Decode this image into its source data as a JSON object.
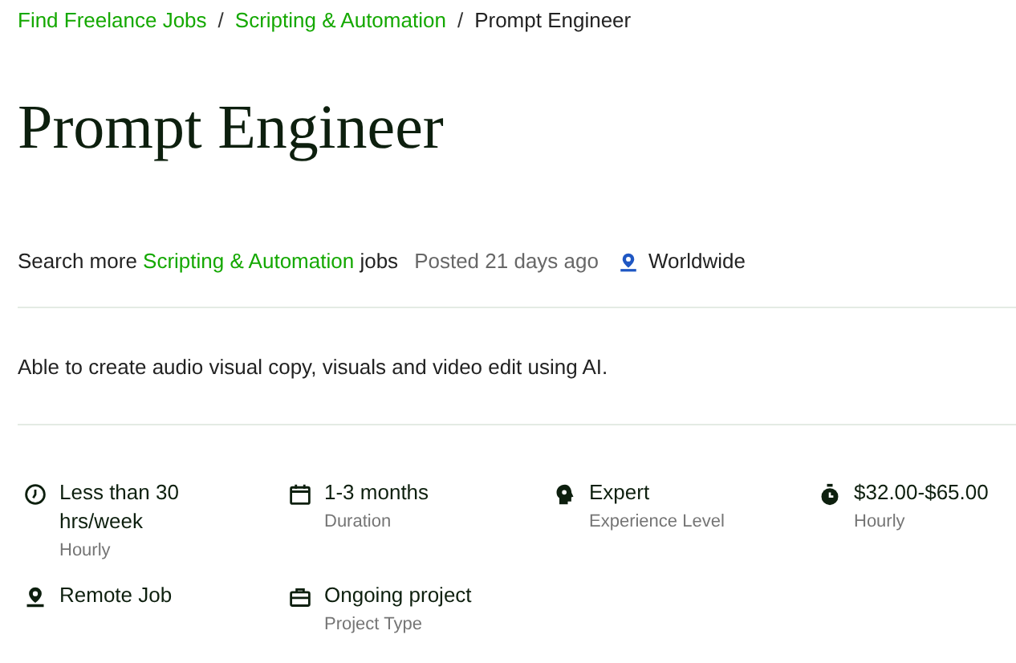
{
  "breadcrumb": [
    {
      "label": "Find Freelance Jobs",
      "link": true
    },
    {
      "separator": "/",
      "label": "Scripting & Automation",
      "link": true
    },
    {
      "separator": "/",
      "label": "Prompt Engineer",
      "link": false
    }
  ],
  "title": "Prompt Engineer",
  "meta": {
    "search_prefix": "Search more",
    "search_link": "Scripting & Automation",
    "search_suffix": "jobs",
    "posted": "Posted 21 days ago",
    "location": "Worldwide"
  },
  "description": "Able to create audio visual copy, visuals and video edit using AI.",
  "features": [
    {
      "kind": "clock",
      "value": "Less than 30 hrs/week",
      "label": "Hourly"
    },
    {
      "kind": "calendar",
      "value": "1-3 months",
      "label": "Duration"
    },
    {
      "kind": "head",
      "value": "Expert",
      "label": "Experience Level"
    },
    {
      "kind": "timer",
      "value": "$32.00-$65.00",
      "label": "Hourly"
    },
    {
      "kind": "pin",
      "value": "Remote Job"
    },
    {
      "kind": "briefcase",
      "value": "Ongoing project",
      "label": "Project Type"
    }
  ]
}
